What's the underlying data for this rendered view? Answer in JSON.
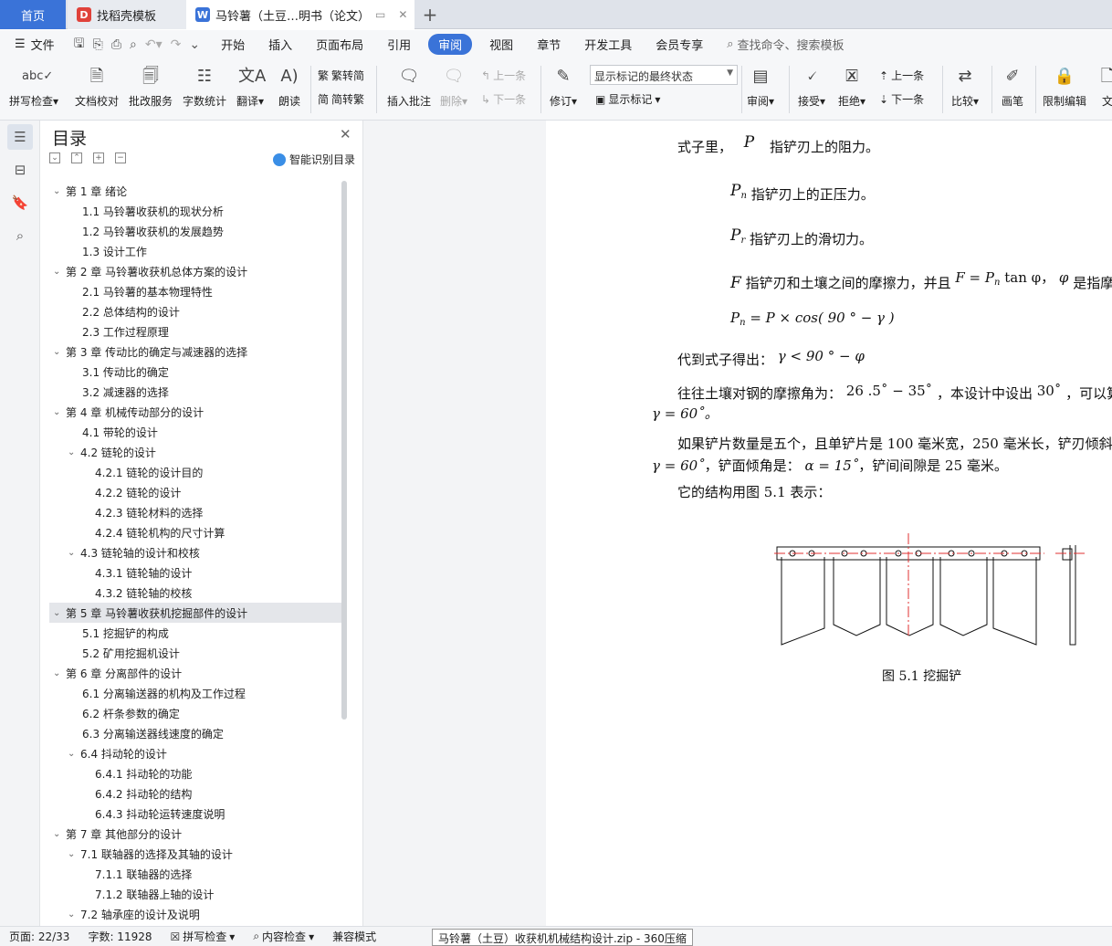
{
  "tabs": {
    "home": "首页",
    "template": "找稻壳模板",
    "doc": "马铃薯（土豆…明书（论文）"
  },
  "menu": {
    "file": "文件",
    "items": [
      "开始",
      "插入",
      "页面布局",
      "引用"
    ],
    "active": "审阅",
    "items2": [
      "视图",
      "章节",
      "开发工具",
      "会员专享"
    ],
    "search": "查找命令、搜索模板"
  },
  "ribbon": {
    "spell": "拼写检查",
    "doc_check": "文档校对",
    "batch": "批改服务",
    "wordcount": "字数统计",
    "translate": "翻译",
    "read": "朗读",
    "trad": "繁转简",
    "simp": "简转繁",
    "insert_comment": "插入批注",
    "delete": "删除",
    "prev": "上一条",
    "next": "下一条",
    "revise": "修订",
    "markup_state": "显示标记的最终状态",
    "show_markup": "显示标记",
    "review": "审阅",
    "accept": "接受",
    "reject": "拒绝",
    "prev2": "上一条",
    "next2": "下一条",
    "compare": "比较",
    "pen": "画笔",
    "restrict": "限制编辑",
    "more": "文"
  },
  "toc": {
    "title": "目录",
    "smart": "智能识别目录",
    "items": [
      {
        "text": "第 1 章  绪论",
        "level": 1
      },
      {
        "text": "1.1 马铃薯收获机的现状分析",
        "level": 2
      },
      {
        "text": "1.2  马铃薯收获机的发展趋势",
        "level": 2
      },
      {
        "text": "1.3 设计工作",
        "level": 2
      },
      {
        "text": "第 2 章   马铃薯收获机总体方案的设计",
        "level": 1
      },
      {
        "text": "2.1  马铃薯的基本物理特性",
        "level": 2
      },
      {
        "text": "2.2  总体结构的设计",
        "level": 2
      },
      {
        "text": "2.3  工作过程原理",
        "level": 2
      },
      {
        "text": "第 3 章   传动比的确定与减速器的选择",
        "level": 1
      },
      {
        "text": "3.1  传动比的确定",
        "level": 2
      },
      {
        "text": "3.2  减速器的选择",
        "level": 2
      },
      {
        "text": "第 4 章  机械传动部分的设计",
        "level": 1
      },
      {
        "text": "4.1  带轮的设计",
        "level": 2
      },
      {
        "text": "4.2  链轮的设计",
        "level": 2,
        "expand": true
      },
      {
        "text": "4.2.1  链轮的设计目的",
        "level": 3
      },
      {
        "text": "4.2.2  链轮的设计",
        "level": 3
      },
      {
        "text": "4.2.3  链轮材料的选择",
        "level": 3
      },
      {
        "text": "4.2.4  链轮机构的尺寸计算",
        "level": 3
      },
      {
        "text": "4.3 链轮轴的设计和校核",
        "level": 2,
        "expand": true
      },
      {
        "text": "4.3.1  链轮轴的设计",
        "level": 3
      },
      {
        "text": "4.3.2  链轮轴的校核",
        "level": 3
      },
      {
        "text": "第 5 章  马铃薯收获机挖掘部件的设计",
        "level": 1,
        "selected": true
      },
      {
        "text": "5.1  挖掘铲的构成",
        "level": 2
      },
      {
        "text": "5.2  矿用挖掘机设计",
        "level": 2
      },
      {
        "text": "第 6 章  分离部件的设计",
        "level": 1
      },
      {
        "text": "6.1  分离输送器的机构及工作过程",
        "level": 2
      },
      {
        "text": "6.2  杆条参数的确定",
        "level": 2
      },
      {
        "text": "6.3  分离输送器线速度的确定",
        "level": 2
      },
      {
        "text": "6.4  抖动轮的设计",
        "level": 2,
        "expand": true
      },
      {
        "text": "6.4.1  抖动轮的功能",
        "level": 3
      },
      {
        "text": "6.4.2  抖动轮的结构",
        "level": 3
      },
      {
        "text": "6.4.3  抖动轮运转速度说明",
        "level": 3
      },
      {
        "text": "第 7 章  其他部分的设计",
        "level": 1
      },
      {
        "text": "7.1 联轴器的选择及其轴的设计",
        "level": 2,
        "expand": true
      },
      {
        "text": "7.1.1  联轴器的选择",
        "level": 3
      },
      {
        "text": "7.1.2  联轴器上轴的设计",
        "level": 3
      },
      {
        "text": "7.2  轴承座的设计及说明",
        "level": 2,
        "expand": true
      }
    ]
  },
  "doc": {
    "l1a": "式子里，",
    "l1b": "P",
    "l1c": "指铲刃上的阻力。",
    "l2a": "P",
    "l2s": "n",
    "l2b": "指铲刃上的正压力。",
    "l3a": "P",
    "l3s": "r",
    "l3b": "指铲刃上的滑切力。",
    "l4a": "F",
    "l4b": "指铲刃和土壤之间的摩擦力，并且",
    "l4c": "F = P",
    "l4s": "n",
    "l4d": "tan φ，",
    "l4e": "φ",
    "l4f": "是指摩",
    "l5a": "P",
    "l5s": "n",
    "l5b": " =  P × cos(  90 ° − γ )",
    "l6a": "代到式子得出：",
    "l6b": "γ  <  90 ° − φ",
    "l7a": "往往土壤对钢的摩擦角为：",
    "l7b": "26 .5˚ − 35˚",
    "l7c": "，本设计中设出",
    "l7d": "30˚",
    "l7e": "，可以算",
    "l8": "γ  =  60˚。",
    "l9": "如果铲片数量是五个，且单铲片是 100 毫米宽，250 毫米长，铲刃倾斜",
    "l10a": "γ  =  60˚",
    "l10b": "，铲面倾角是：",
    "l10c": "α  = 15˚",
    "l10d": "，铲间间隙是 25 毫米。",
    "l11": "它的结构用图 5.1 表示：",
    "caption": "图 5.1  挖掘铲"
  },
  "status": {
    "page": "页面: 22/33",
    "words": "字数: 11928",
    "spell": "拼写检查",
    "content": "内容检查",
    "compat": "兼容模式",
    "zip": "马铃薯（土豆）收获机机械结构设计.zip - 360压缩"
  },
  "colors": {
    "accent": "#3a73d8",
    "centerline": "#e03030"
  }
}
